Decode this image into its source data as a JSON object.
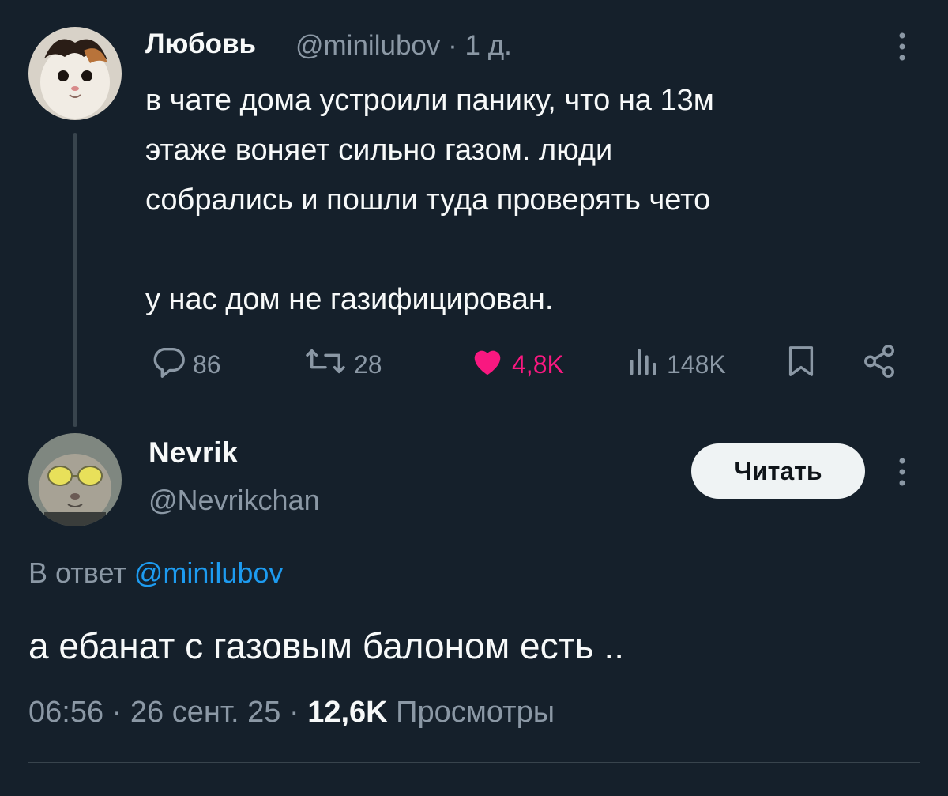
{
  "tweet": {
    "author_name": "Любовь",
    "author_handle": "@minilubov",
    "time_ago": "1 д.",
    "text": "в чате дома устроили панику, что на 13м\nэтаже воняет сильно газом. люди\nсобрались и пошли туда проверять чето\n\nу нас дом не газифицирован.",
    "actions": {
      "replies": "86",
      "reposts": "28",
      "likes": "4,8K",
      "views": "148K"
    },
    "colors": {
      "like": "#f91880",
      "muted": "#8b98a5"
    }
  },
  "reply": {
    "author_name": "Nevrik",
    "author_handle": "@Nevrikchan",
    "follow_label": "Читать",
    "in_reply_to_prefix": "В ответ",
    "in_reply_to_handle": "@minilubov",
    "text": "а ебанат с газовым балоном есть ..",
    "time": "06:56",
    "date": "26 сент. 25",
    "views_count": "12,6K",
    "views_label": "Просмотры"
  },
  "icons": [
    "more-icon",
    "reply-icon",
    "repost-icon",
    "heart-icon",
    "views-icon",
    "bookmark-icon",
    "share-icon"
  ]
}
